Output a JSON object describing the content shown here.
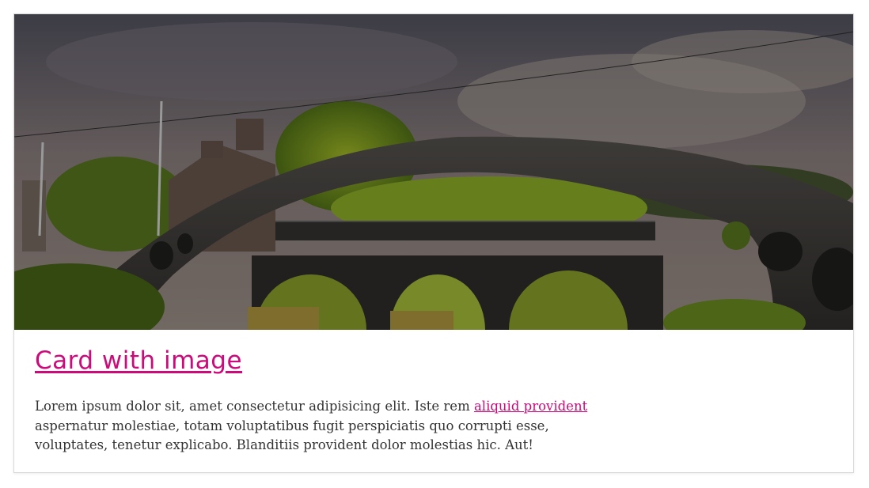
{
  "card": {
    "image_alt": "Stone arched bridge over a river with trees and houses",
    "title": "Card with image",
    "text_before": "Lorem ipsum dolor sit, amet consectetur adipisicing elit. Iste rem ",
    "link_text": "aliquid provident",
    "text_after": " aspernatur molestiae, totam voluptatibus fugit perspiciatis quo corrupti esse, voluptates, tenetur explicabo. Blanditiis provident dolor molestias hic. Aut!"
  },
  "colors": {
    "accent": "#cc0a7a",
    "body_text": "#333333",
    "border": "#d9d9d9"
  }
}
